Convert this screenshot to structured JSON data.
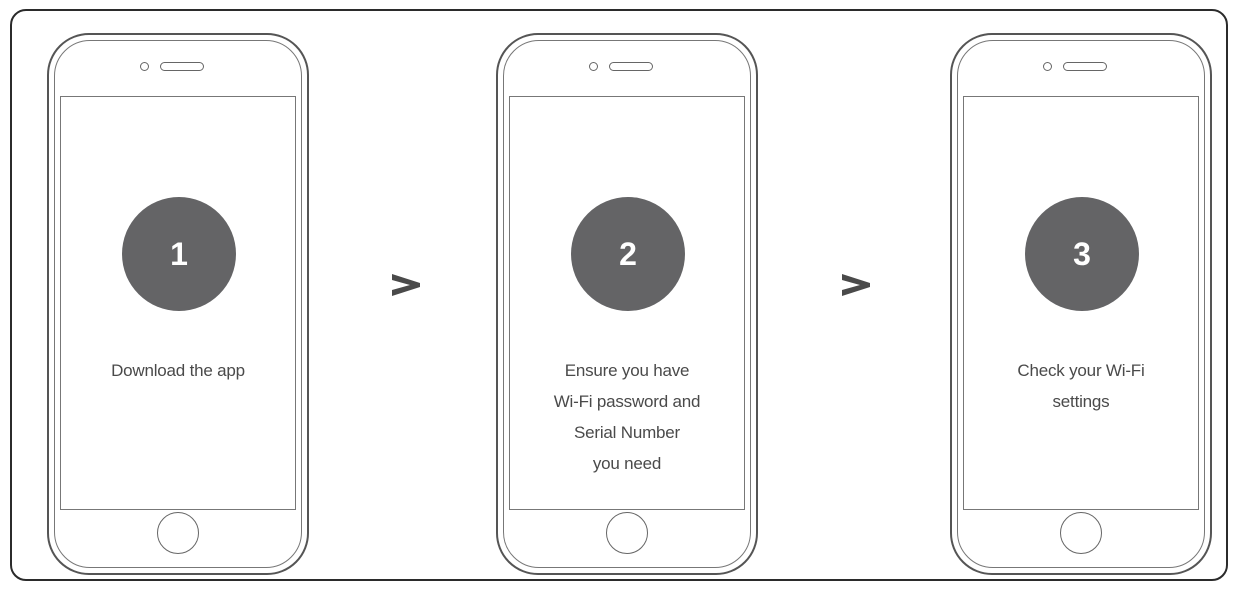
{
  "steps": [
    {
      "number": "1",
      "text": "Download the app"
    },
    {
      "number": "2",
      "text": "Ensure you have\nWi-Fi password and\nSerial Number\nyou need"
    },
    {
      "number": "3",
      "text": "Check your Wi-Fi\nsettings"
    }
  ],
  "arrows": [
    ">",
    ">"
  ],
  "colors": {
    "circle": "#646466",
    "text": "#4a4a4a",
    "outline": "#555555"
  }
}
